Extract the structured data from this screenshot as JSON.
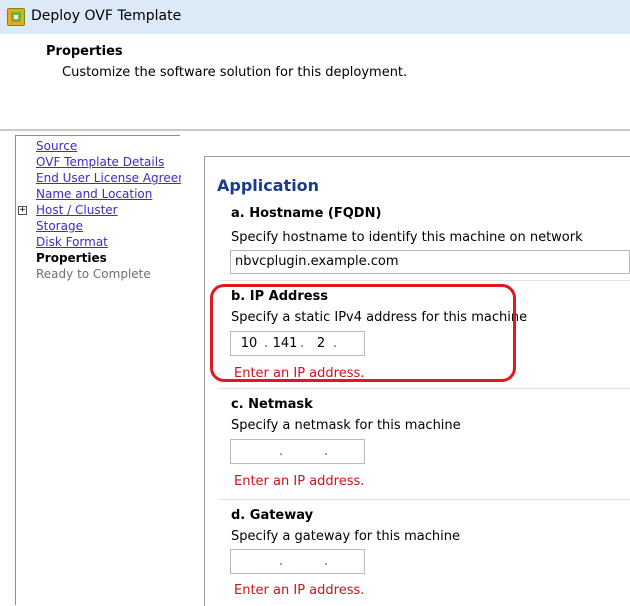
{
  "window": {
    "title": "Deploy OVF Template",
    "icon": "vsphere-app-icon"
  },
  "header": {
    "title": "Properties",
    "subtitle": "Customize the software solution for this deployment."
  },
  "nav": {
    "items": [
      {
        "label": "Source",
        "state": "link"
      },
      {
        "label": "OVF Template Details",
        "state": "link"
      },
      {
        "label": "End User License Agreement",
        "state": "link"
      },
      {
        "label": "Name and Location",
        "state": "link"
      },
      {
        "label": "Host / Cluster",
        "state": "link",
        "expandable": true,
        "expand_glyph": "+"
      },
      {
        "label": "Storage",
        "state": "link"
      },
      {
        "label": "Disk Format",
        "state": "link"
      },
      {
        "label": "Properties",
        "state": "current"
      },
      {
        "label": "Ready to Complete",
        "state": "disabled"
      }
    ]
  },
  "main": {
    "section_title": "Application",
    "hostname": {
      "label": "a. Hostname (FQDN)",
      "description": "Specify hostname to identify this machine on network",
      "value": "nbvcplugin.example.com"
    },
    "ip_address": {
      "label": "b. IP Address",
      "description": "Specify a static IPv4 address for this machine",
      "octets": [
        "10",
        "141",
        "2",
        ""
      ],
      "error": "Enter an IP address."
    },
    "netmask": {
      "label": "c. Netmask",
      "description": "Specify a netmask for this machine",
      "octets": [
        "",
        "",
        "",
        ""
      ],
      "error": "Enter an IP address."
    },
    "gateway": {
      "label": "d. Gateway",
      "description": "Specify a gateway for this machine",
      "octets": [
        "",
        "",
        "",
        ""
      ],
      "error": "Enter an IP address."
    }
  },
  "colors": {
    "title_bar": "#dce9f6",
    "link": "#3b2ccb",
    "section_title": "#1a3c8f",
    "error": "#d0121b",
    "highlight": "#e0191e"
  }
}
